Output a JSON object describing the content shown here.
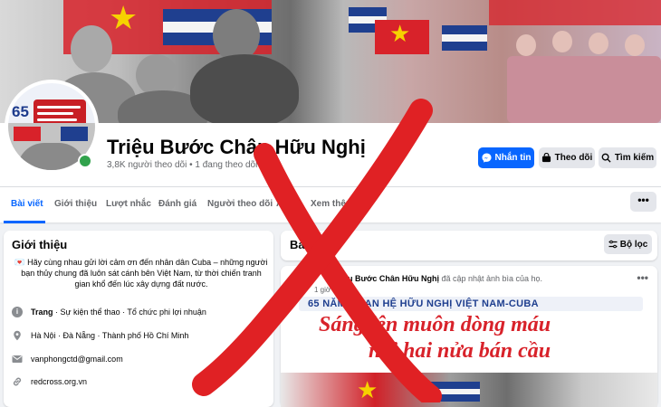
{
  "page": {
    "title": "Triệu Bước Chân Hữu Nghị",
    "followers": "3,8K người theo dõi • 1 đang theo dõi"
  },
  "avatar": {
    "number": "65"
  },
  "actions": {
    "message_label": "Nhắn tin",
    "follow_label": "Theo dõi",
    "search_label": "Tìm kiếm",
    "more_label": "•••"
  },
  "tabs": [
    {
      "label": "Bài viết",
      "active": true
    },
    {
      "label": "Giới thiệu"
    },
    {
      "label": "Lượt nhắc"
    },
    {
      "label": "Đánh giá"
    },
    {
      "label": "Người theo dõi"
    },
    {
      "label": "Ảnh"
    },
    {
      "label": "Xem thêm"
    }
  ],
  "intro": {
    "title": "Giới thiệu",
    "description": "💌 Hãy cùng nhau gửi lời cảm ơn đến nhân dân Cuba – những người bạn thủy chung đã luôn sát cánh bên Việt Nam, từ thời chiến tranh gian khổ đến lúc xây dựng đất nước.",
    "category_bold": "Trang",
    "category_rest": " · Sự kiện thể thao · Tổ chức phi lợi nhuận",
    "location": "Hà Nội · Đà Nẵng · Thành phố Hồ Chí Minh",
    "email": "vanphongctd@gmail.com",
    "website": "redcross.org.vn"
  },
  "posts": {
    "title": "Bài viết",
    "filter_label": "Bộ lọc"
  },
  "post": {
    "author": "Triệu Bước Chân Hữu Nghị",
    "action": " đã cập nhật ảnh bìa của họ.",
    "time": "1 giờ",
    "more": "•••",
    "banner_heading": "65 NĂM QUAN HỆ HỮU NGHỊ VIỆT NAM-CUBA",
    "banner_line1": "Sáng lên muôn dòng máu",
    "banner_line2": "nối hai nửa bán cầu"
  },
  "colors": {
    "accent": "#0866ff",
    "overlay_x": "#e02124",
    "flag_red": "#d8222a",
    "flag_blue": "#1f3f8f"
  },
  "icons": [
    "messenger-icon",
    "follow-icon",
    "search-icon",
    "filter-icon",
    "info-icon",
    "location-icon",
    "email-icon",
    "link-icon"
  ]
}
